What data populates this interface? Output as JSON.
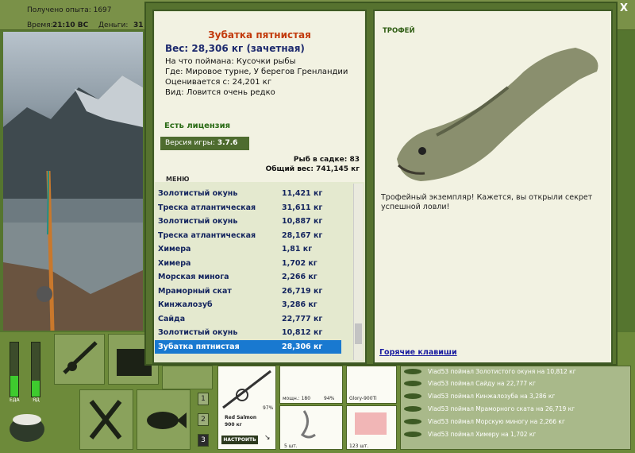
{
  "topbar": {
    "experience": "Получено опыта: 1697",
    "time_label": "Время:",
    "time_value": "21:10 ВС",
    "money_label": "Деньги:",
    "money_value": "31"
  },
  "catch": {
    "name": "Зубатка пятнистая",
    "weight": "Вес: 28,306 кг (зачетная)",
    "bait": "На что поймана: Кусочки рыбы",
    "location": "Где: Мировое турне, У берегов Гренландии",
    "valued": "Оценивается с: 24,201 кг",
    "rarity": "Вид: Ловится очень редко"
  },
  "license": "Есть лицензия",
  "version": {
    "label": "Версия игры:",
    "value": "3.7.6"
  },
  "menu": "МЕНЮ",
  "stats": {
    "in_keepnet": "Рыб в садке: 83",
    "total_weight": "Общий вес: 741,145 кг"
  },
  "fish_list": [
    {
      "name": "Золотистый окунь",
      "weight": "11,421 кг"
    },
    {
      "name": "Треска атлантическая",
      "weight": "31,611 кг"
    },
    {
      "name": "Золотистый окунь",
      "weight": "10,887 кг"
    },
    {
      "name": "Треска атлантическая",
      "weight": "28,167 кг"
    },
    {
      "name": "Химера",
      "weight": "1,81 кг"
    },
    {
      "name": "Химера",
      "weight": "1,702 кг"
    },
    {
      "name": "Морская минога",
      "weight": "2,266 кг"
    },
    {
      "name": "Мраморный скат",
      "weight": "26,719 кг"
    },
    {
      "name": "Кинжалозуб",
      "weight": "3,286 кг"
    },
    {
      "name": "Сайда",
      "weight": "22,777 кг"
    },
    {
      "name": "Золотистый окунь",
      "weight": "10,812 кг"
    },
    {
      "name": "Зубатка пятнистая",
      "weight": "28,306 кг",
      "selected": true
    }
  ],
  "trophy": {
    "title": "ТРОФЕЙ",
    "text": "Трофейный экземпляр! Кажется, вы открыли секрет успешной ловли!"
  },
  "hotkeys": "Горячие клавиши",
  "close": "X",
  "gauges": {
    "food_label": "ЕДА",
    "poison_label": "ЯД",
    "food_level": 0.38,
    "poison_level": 0.3
  },
  "numbers": [
    "1",
    "2",
    "3"
  ],
  "rod": {
    "percent": "97%",
    "line": "Red Salmon",
    "line_weight": "900 кг",
    "setup_button": "НАСТРОИТЬ"
  },
  "reel": {
    "power": "мощн.: 180",
    "percent": "94%"
  },
  "line_item": "Glory-900Ti",
  "lure": {
    "count": "5 шт."
  },
  "bait_item": {
    "count": "123 шт."
  },
  "log": [
    "Vlad53 поймал Золотистого окуня на 10,812 кг",
    "Vlad53 поймал Сайду на 22,777 кг",
    "Vlad53 поймал Кинжалозуба на 3,286 кг",
    "Vlad53 поймал Мраморного ската на 26,719 кг",
    "Vlad53 поймал Морскую миногу на 2,266 кг",
    "Vlad53 поймал Химеру на 1,702 кг"
  ],
  "colors": {
    "accent": "#56722f",
    "selection": "#1979d0",
    "fish_name": "#c23a0c"
  }
}
